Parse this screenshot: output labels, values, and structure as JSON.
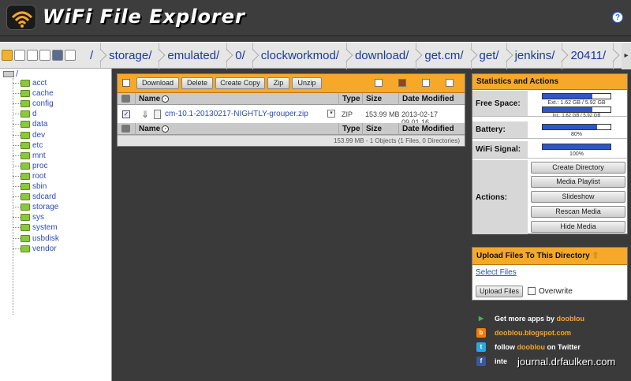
{
  "header": {
    "app_title": "WiFi File Explorer",
    "help_glyph": "?"
  },
  "breadcrumbs": [
    "/",
    "storage/",
    "emulated/",
    "0/",
    "clockworkmod/",
    "download/",
    "get.cm/",
    "get/",
    "jenkins/",
    "20411/"
  ],
  "crumb_more_glyph": "▸",
  "tree": {
    "root": "/",
    "items": [
      "acct",
      "cache",
      "config",
      "d",
      "data",
      "dev",
      "etc",
      "mnt",
      "proc",
      "root",
      "sbin",
      "sdcard",
      "storage",
      "sys",
      "system",
      "usbdisk",
      "vendor"
    ]
  },
  "toolbar": {
    "download": "Download",
    "delete": "Delete",
    "create_copy": "Create Copy",
    "zip": "Zip",
    "unzip": "Unzip"
  },
  "columns": {
    "name": "Name",
    "type": "Type",
    "size": "Size",
    "date": "Date Modified"
  },
  "sort_glyph": "-",
  "file": {
    "checked_glyph": "✓",
    "download_glyph": "⇓",
    "dropdown_glyph": "▾",
    "name": "cm-10.1-20130217-NIGHTLY-grouper.zip",
    "type": "ZIP",
    "size": "153.99 MB",
    "date": "2013-02-17 09.01.16"
  },
  "status_line": "153.99 MB - 1 Objects (1 Files, 0 Directories)",
  "stats": {
    "title": "Statistics and Actions",
    "free_space_label": "Free Space:",
    "ext_label": "Ext.: 1.62 GB / 5.92 GB",
    "ext_fraction": 0.73,
    "int_label": "Int.: 1.62 GB / 5.92 GB",
    "int_fraction": 0.73,
    "battery_label": "Battery:",
    "battery_text": "80%",
    "battery_fraction": 0.8,
    "wifi_label": "WiFi Signal:",
    "wifi_text": "100%",
    "wifi_fraction": 1.0,
    "actions_label": "Actions:",
    "actions": [
      "Create Directory",
      "Media Playlist",
      "Slideshow",
      "Rescan Media",
      "Hide Media"
    ]
  },
  "upload": {
    "title": "Upload Files To This Directory",
    "arrow_glyph": "⇧",
    "select_files": "Select Files",
    "upload_button": "Upload Files",
    "overwrite_label": "Overwrite"
  },
  "promo": {
    "play_glyph": "▶",
    "blog_glyph": "b",
    "twitter_glyph": "t",
    "facebook_glyph": "f",
    "more_apps_prefix": "Get more apps by",
    "more_apps_brand": "dooblou",
    "blog_link": "dooblou.blogspot.com",
    "twitter_prefix": "follow",
    "twitter_brand": "dooblou",
    "twitter_suffix": "on Twitter",
    "facebook_partial": "inte"
  },
  "watermark": "journal.drfaulken.com",
  "colors": {
    "accent_orange": "#f5a82a",
    "link_blue": "#2c4cb8",
    "bar_blue": "#2f55c8",
    "folder_green": "#8dc63f"
  }
}
